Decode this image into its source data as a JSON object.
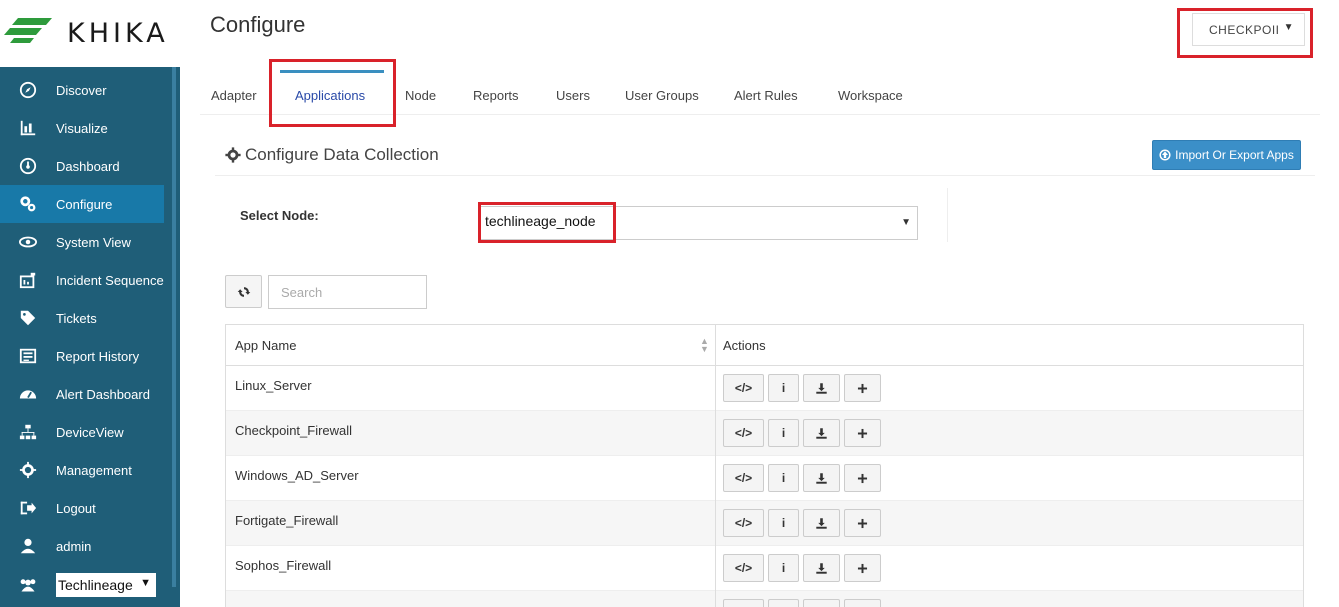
{
  "app": {
    "brand": "KHIKA",
    "page_title": "Configure"
  },
  "colors": {
    "sidebar": "#1f5e78",
    "sidebar_active": "#1879a8",
    "accent": "#3b8fc8",
    "highlight": "#d9222a"
  },
  "sidebar": {
    "items": [
      {
        "label": "Discover",
        "icon": "compass-icon"
      },
      {
        "label": "Visualize",
        "icon": "bar-chart-icon"
      },
      {
        "label": "Dashboard",
        "icon": "dashboard-icon"
      },
      {
        "label": "Configure",
        "icon": "cogs-icon",
        "active": true
      },
      {
        "label": "System View",
        "icon": "eye-icon"
      },
      {
        "label": "Incident Sequence",
        "icon": "sequence-icon"
      },
      {
        "label": "Tickets",
        "icon": "tag-icon"
      },
      {
        "label": "Report History",
        "icon": "list-icon"
      },
      {
        "label": "Alert Dashboard",
        "icon": "tachometer-icon"
      },
      {
        "label": "DeviceView",
        "icon": "sitemap-icon"
      },
      {
        "label": "Management",
        "icon": "gear-icon"
      },
      {
        "label": "Logout",
        "icon": "sign-out-icon"
      },
      {
        "label": "admin",
        "icon": "user-icon"
      }
    ],
    "org_select": {
      "value": "Techlineage",
      "icon": "users-icon"
    }
  },
  "header": {
    "workspace_select": "CHECKPOII"
  },
  "tabs": [
    {
      "label": "Adapter"
    },
    {
      "label": "Applications",
      "active": true
    },
    {
      "label": "Node"
    },
    {
      "label": "Reports"
    },
    {
      "label": "Users"
    },
    {
      "label": "User Groups"
    },
    {
      "label": "Alert Rules"
    },
    {
      "label": "Workspace"
    }
  ],
  "section": {
    "title": "Configure Data Collection",
    "import_button": "Import Or Export Apps",
    "select_node_label": "Select Node:",
    "selected_node": "techlineage_node"
  },
  "search": {
    "placeholder": "Search"
  },
  "table": {
    "columns": [
      "App Name",
      "Actions"
    ],
    "rows": [
      {
        "name": "Linux_Server"
      },
      {
        "name": "Checkpoint_Firewall"
      },
      {
        "name": "Windows_AD_Server"
      },
      {
        "name": "Fortigate_Firewall"
      },
      {
        "name": "Sophos_Firewall"
      }
    ],
    "action_icons": [
      "code-icon",
      "info-icon",
      "download-icon",
      "plus-icon"
    ]
  }
}
